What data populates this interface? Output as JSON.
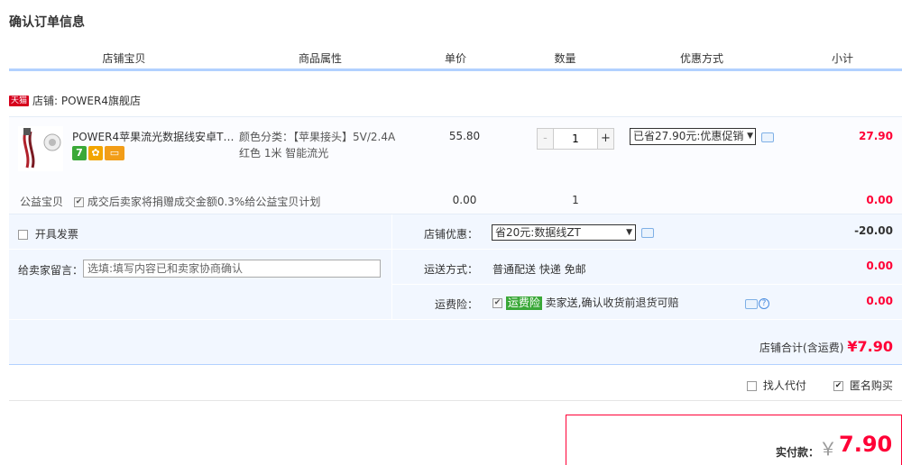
{
  "page_title": "确认订单信息",
  "columns": [
    "店铺宝贝",
    "商品属性",
    "单价",
    "数量",
    "优惠方式",
    "小计"
  ],
  "shop": {
    "badge": "天猫",
    "label": "店铺: POWER4旗舰店"
  },
  "item": {
    "title": "POWER4苹果流光数据线安卓TY...",
    "icons": [
      "seven-day-return-icon",
      "guarantee-shield-icon",
      "credit-card-icon"
    ],
    "icon_glyphs": [
      "7",
      "✿",
      "▭"
    ],
    "attr_line1": "颜色分类：【苹果接头】5V/2.4A",
    "attr_line2": "红色 1米 智能流光",
    "price": "55.80",
    "qty_minus": "-",
    "qty_value": "1",
    "qty_plus": "+",
    "promo": "已省27.90元:优惠促销",
    "subtotal": "27.90"
  },
  "charity": {
    "label": "公益宝贝",
    "check_text": "成交后卖家将捐赠成交金额0.3%给公益宝贝计划",
    "price": "0.00",
    "qty": "1",
    "subtotal": "0.00"
  },
  "options": {
    "invoice_label": "开具发票",
    "message_label": "给卖家留言：",
    "message_placeholder": "选填:填写内容已和卖家协商确认",
    "shop_discount_label": "店铺优惠：",
    "shop_discount_value": "省20元:数据线ZT",
    "shop_discount_amount": "-20.00",
    "shipping_label": "运送方式：",
    "shipping_value": "普通配送 快递 免邮",
    "shipping_amount": "0.00",
    "insurance_label": "运费险：",
    "insurance_tag": "运费险",
    "insurance_text": "卖家送,确认收货前退货可赔",
    "insurance_amount": "0.00",
    "help_glyph": "?",
    "total_label": "店铺合计(含运费)",
    "total_value": "¥7.90"
  },
  "extra": {
    "proxy_pay": "找人代付",
    "anonymous": "匿名购买"
  },
  "payment": {
    "label": "实付款：",
    "currency": "￥",
    "amount": "7.90"
  },
  "colors": {
    "accent_red": "#ff0036",
    "header_border": "#b2d1ff",
    "panel_bg": "#f2f7ff",
    "green": "#3aa838"
  }
}
